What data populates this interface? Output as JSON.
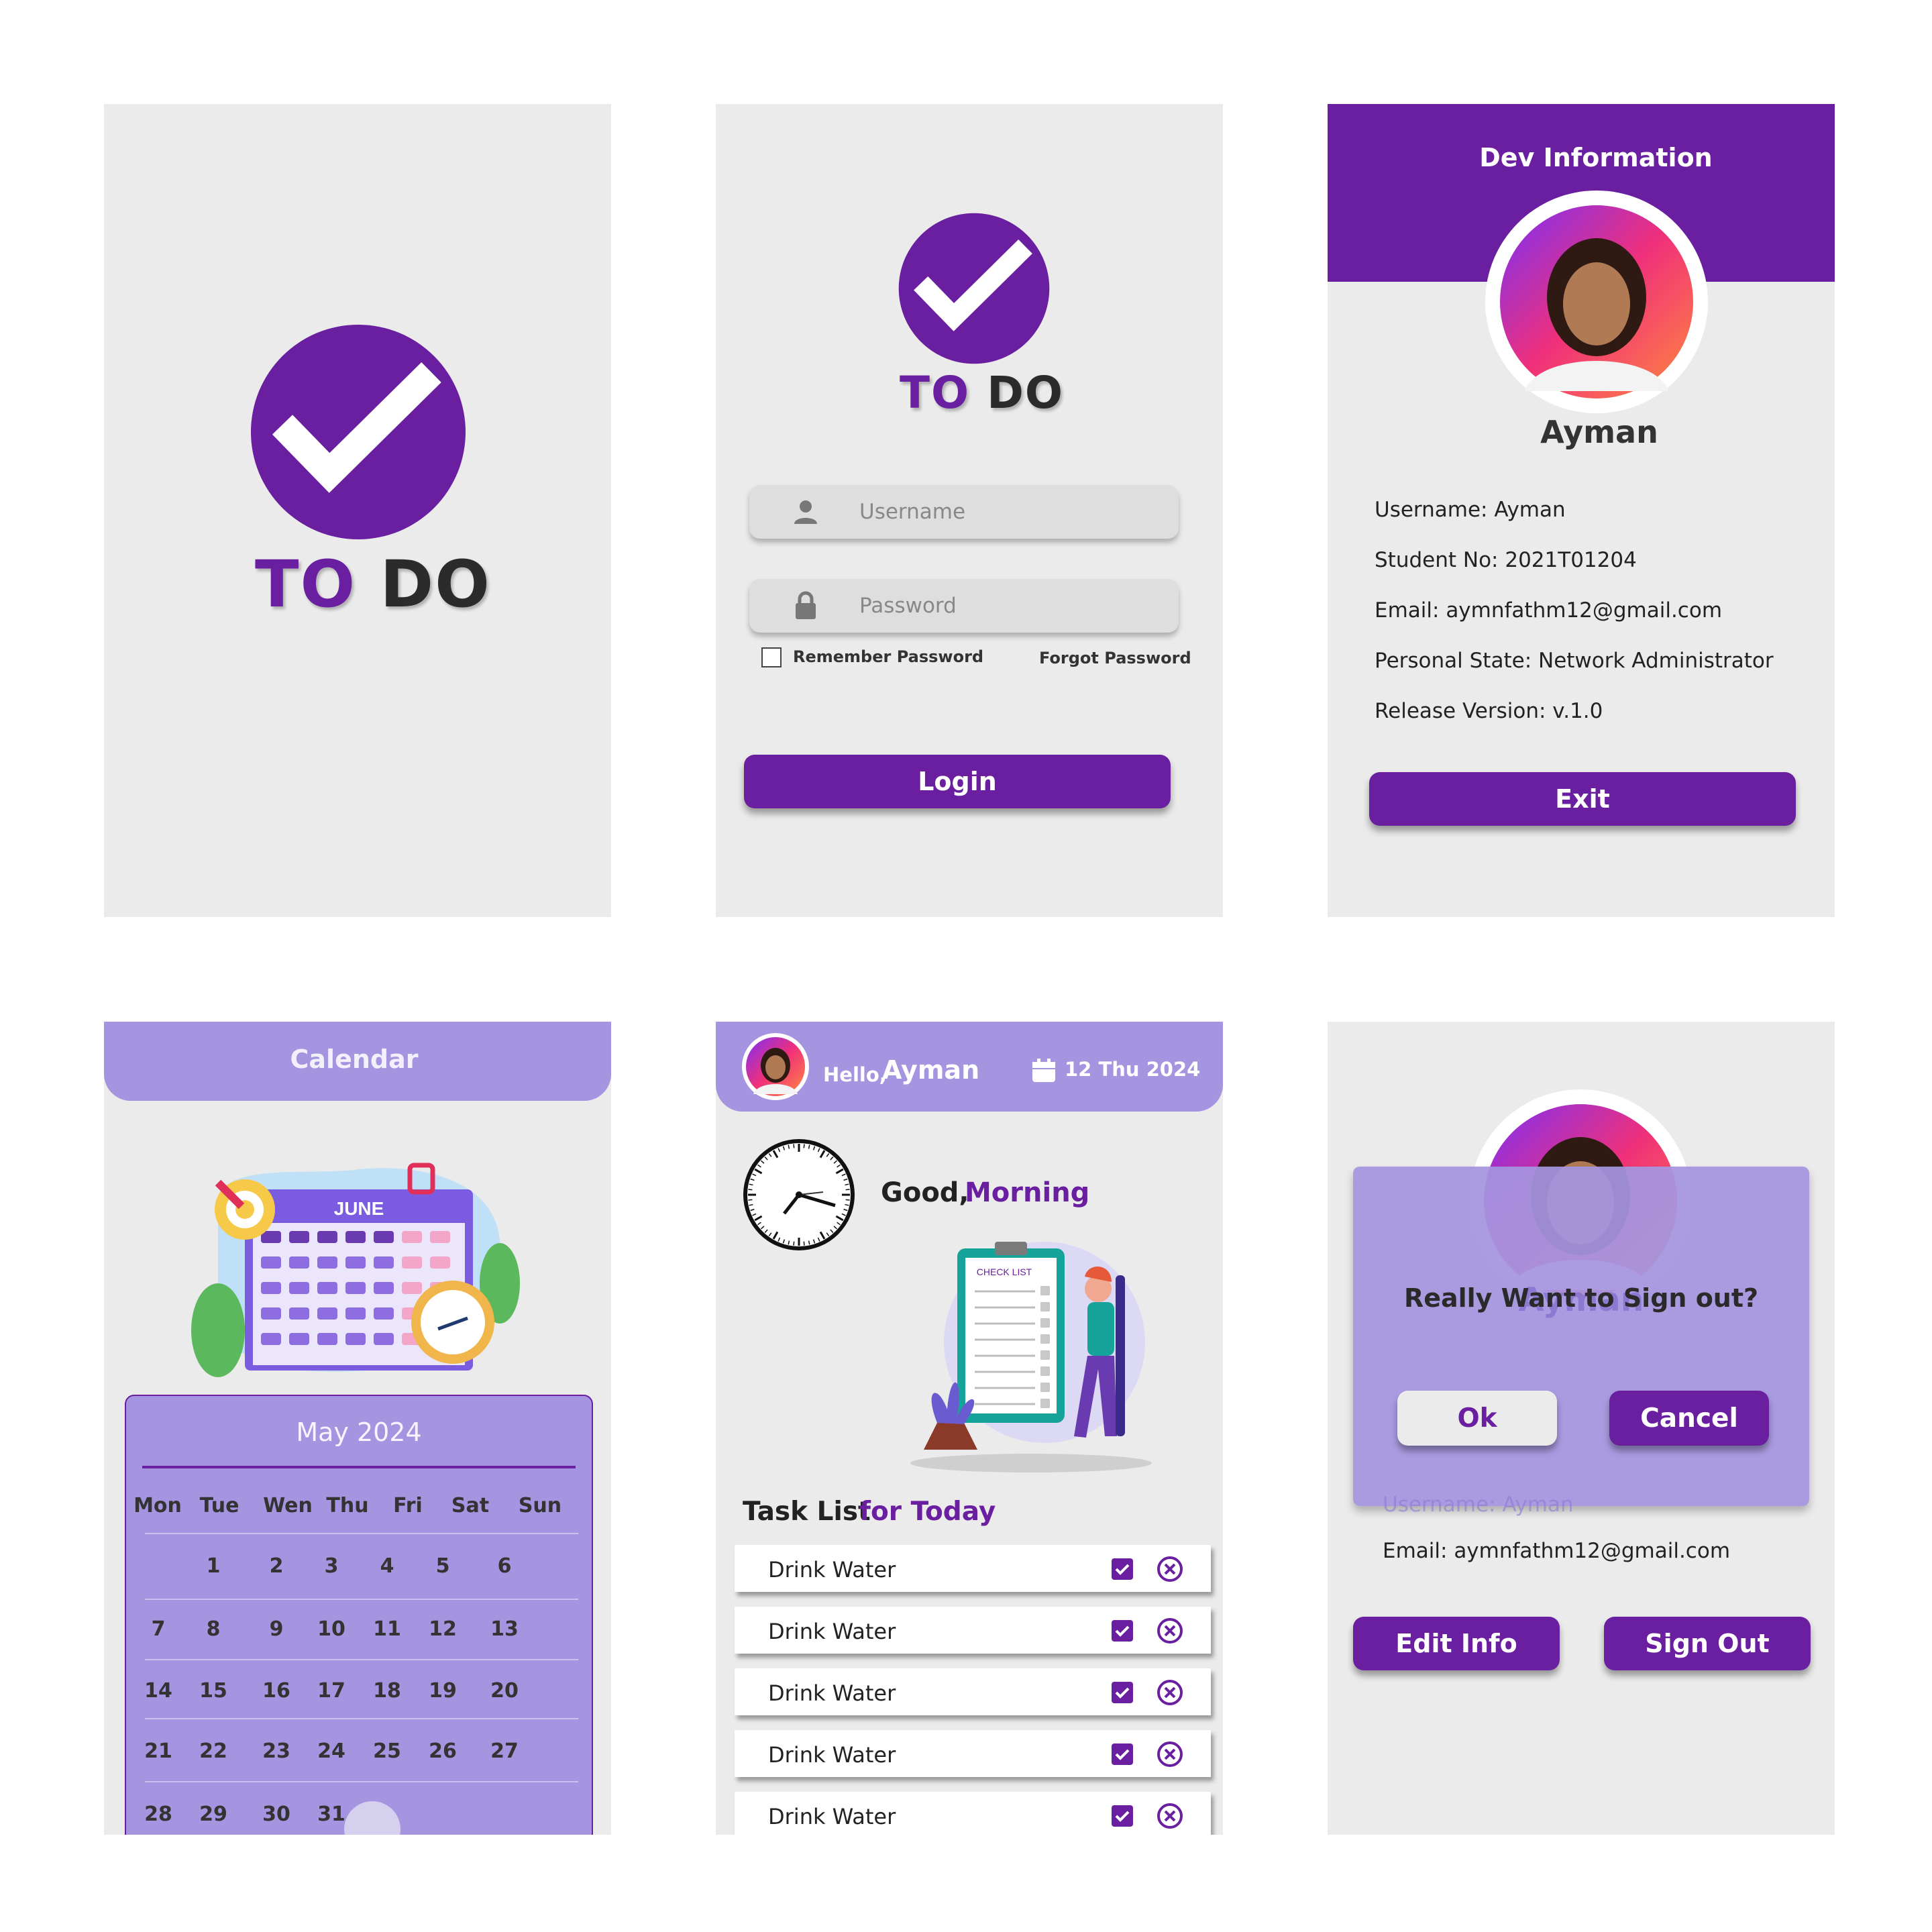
{
  "colors": {
    "brand": "#6a1fa0",
    "lavender": "#a594e0",
    "screen_bg": "#ebebeb"
  },
  "splash": {
    "logo_to": "TO",
    "logo_do": "DO"
  },
  "login": {
    "logo_to": "TO",
    "logo_do": "DO",
    "username_placeholder": "Username",
    "password_placeholder": "Password",
    "remember_label": "Remember Password",
    "forgot_label": "Forgot Password",
    "login_label": "Login"
  },
  "dev_info": {
    "title": "Dev Information",
    "name": "Ayman",
    "rows": [
      {
        "label": "Username:",
        "value": "Ayman"
      },
      {
        "label": "Student No:",
        "value": "2021T01204"
      },
      {
        "label": "Email:",
        "value": "aymnfathm12@gmail.com"
      },
      {
        "label": "Personal State:",
        "value": "Network Administrator"
      },
      {
        "label": "Release Version:",
        "value": "v.1.0"
      }
    ],
    "exit_label": "Exit"
  },
  "calendar": {
    "title": "Calendar",
    "illustration_month": "JUNE",
    "month_title": "May 2024",
    "weekdays": [
      "Mon",
      "Tue",
      "Wen",
      "Thu",
      "Fri",
      "Sat",
      "Sun"
    ],
    "weeks": [
      [
        "",
        "1",
        "2",
        "3",
        "4",
        "5",
        "6"
      ],
      [
        "7",
        "8",
        "9",
        "10",
        "11",
        "12",
        "13"
      ],
      [
        "14",
        "15",
        "16",
        "17",
        "18",
        "19",
        "20"
      ],
      [
        "21",
        "22",
        "23",
        "24",
        "25",
        "26",
        "27"
      ],
      [
        "28",
        "29",
        "30",
        "31",
        "",
        "",
        ""
      ]
    ],
    "selected_day": "31"
  },
  "home": {
    "hello": "Hello,",
    "user": "Ayman",
    "date": "12 Thu 2024",
    "greet_1": "Good,",
    "greet_2": "Morning",
    "checklist_label": "CHECK LIST",
    "task_title_1": "Task List",
    "task_title_2": "for Today",
    "tasks": [
      "Drink Water",
      "Drink Water",
      "Drink Water",
      "Drink Water",
      "Drink Water"
    ]
  },
  "signout": {
    "question": "Really Want to Sign out?",
    "faded_name": "Ayman",
    "faded_username": "Username:  Ayman",
    "ok_label": "Ok",
    "cancel_label": "Cancel",
    "email_label": "Email:",
    "email_value": "aymnfathm12@gmail.com",
    "edit_label": "Edit Info",
    "signout_label": "Sign Out"
  }
}
